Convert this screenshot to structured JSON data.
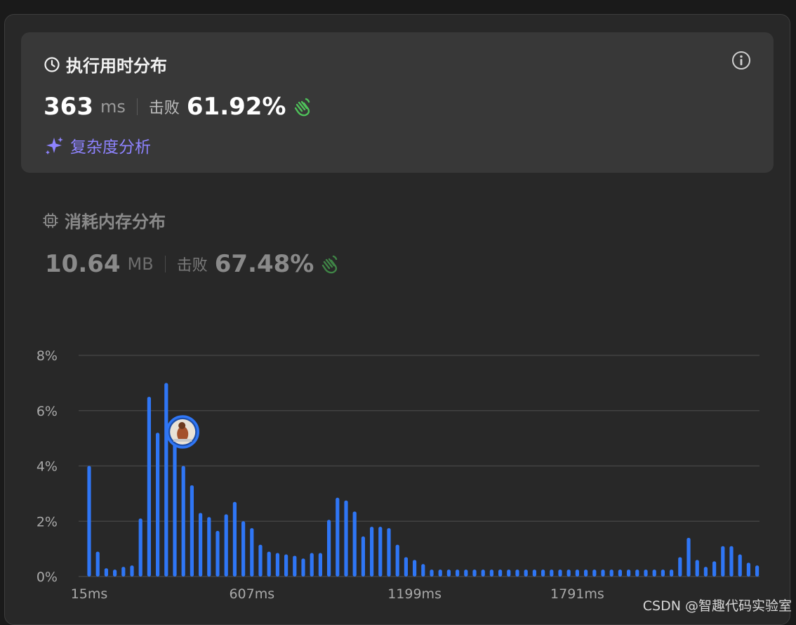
{
  "runtime": {
    "title": "执行用时分布",
    "value": "363",
    "unit": "ms",
    "beat_label": "击败",
    "beat_pct": "61.92%",
    "complexity_link": "复杂度分析"
  },
  "memory": {
    "title": "消耗内存分布",
    "value": "10.64",
    "unit": "MB",
    "beat_label": "击败",
    "beat_pct": "67.48%"
  },
  "colors": {
    "bar": "#2f76f5",
    "grid": "#474747",
    "axis_text": "#a9a9a9",
    "accent_purple": "#8e83ff",
    "hands_green": "#4fc25a"
  },
  "chart_data": {
    "type": "bar",
    "x_tick_labels": [
      "15ms",
      "607ms",
      "1199ms",
      "1791ms"
    ],
    "y_tick_labels": [
      "0%",
      "2%",
      "4%",
      "6%",
      "8%"
    ],
    "ylim": [
      0,
      8
    ],
    "grid": true,
    "marker_bin_index": 11,
    "series": [
      {
        "values": [
          4.0,
          0.9,
          0.3,
          0.25,
          0.35,
          0.4,
          2.1,
          6.5,
          5.2,
          7.0,
          4.9,
          4.0,
          3.3,
          2.3,
          2.15,
          1.65,
          2.25,
          2.7,
          2.0,
          1.75,
          1.15,
          0.9,
          0.85,
          0.8,
          0.75,
          0.65,
          0.85,
          0.85,
          2.05,
          2.85,
          2.75,
          2.35,
          1.45,
          1.8,
          1.8,
          1.75,
          1.15,
          0.7,
          0.6,
          0.45,
          0.25,
          0.25,
          0.25,
          0.25,
          0.25,
          0.25,
          0.25,
          0.25,
          0.25,
          0.25,
          0.25,
          0.25,
          0.25,
          0.25,
          0.25,
          0.25,
          0.25,
          0.25,
          0.25,
          0.25,
          0.25,
          0.25,
          0.25,
          0.25,
          0.25,
          0.25,
          0.25,
          0.25,
          0.25,
          0.7,
          1.4,
          0.6,
          0.35,
          0.55,
          1.1,
          1.1,
          0.8,
          0.5,
          0.4
        ]
      }
    ]
  },
  "watermark": "CSDN @智趣代码实验室"
}
